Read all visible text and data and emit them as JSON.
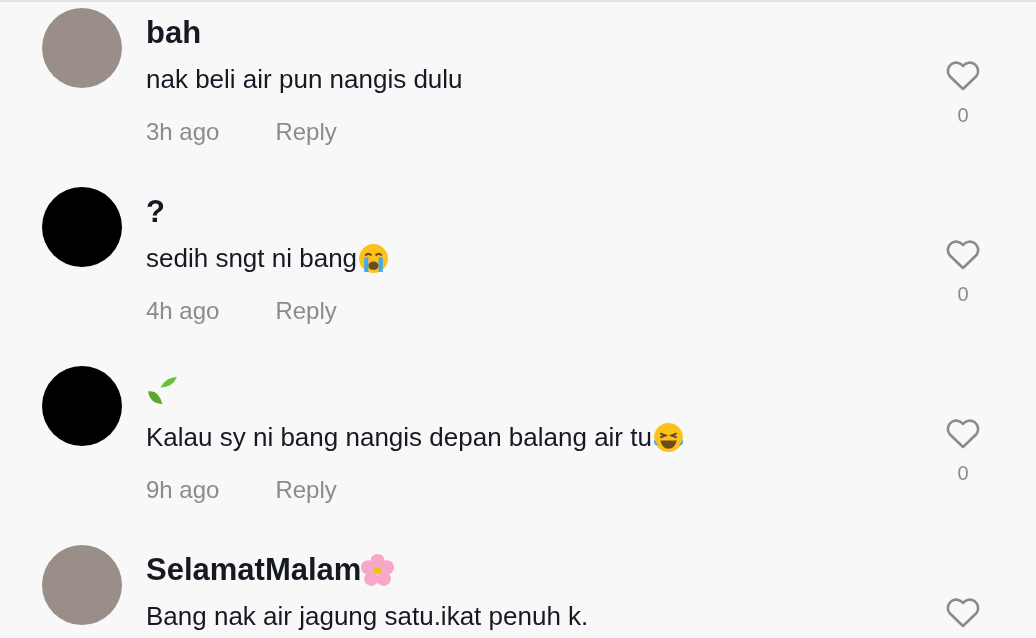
{
  "comments": [
    {
      "avatar": {
        "kind": "photo"
      },
      "name": "bah",
      "text": "nak beli air pun nangis dulu",
      "time": "3h ago",
      "reply": "Reply",
      "likes": "0"
    },
    {
      "avatar": {
        "kind": "blank"
      },
      "name": "?",
      "text": "sedih sngt ni bang",
      "text_icon": {
        "kind": "crying"
      },
      "time": "4h ago",
      "reply": "Reply",
      "likes": "0"
    },
    {
      "avatar": {
        "kind": "blank"
      },
      "name_icon": {
        "kind": "leaf"
      },
      "text": "Kalau sy ni bang nangis depan balang air tu",
      "text_icon": {
        "kind": "laughing"
      },
      "time": "9h ago",
      "reply": "Reply",
      "likes": "0"
    },
    {
      "avatar": {
        "kind": "photo"
      },
      "name": "SelamatMalam",
      "name_icon": {
        "kind": "flower"
      },
      "text": "Bang nak air jagung satu.ikat penuh k."
    }
  ]
}
